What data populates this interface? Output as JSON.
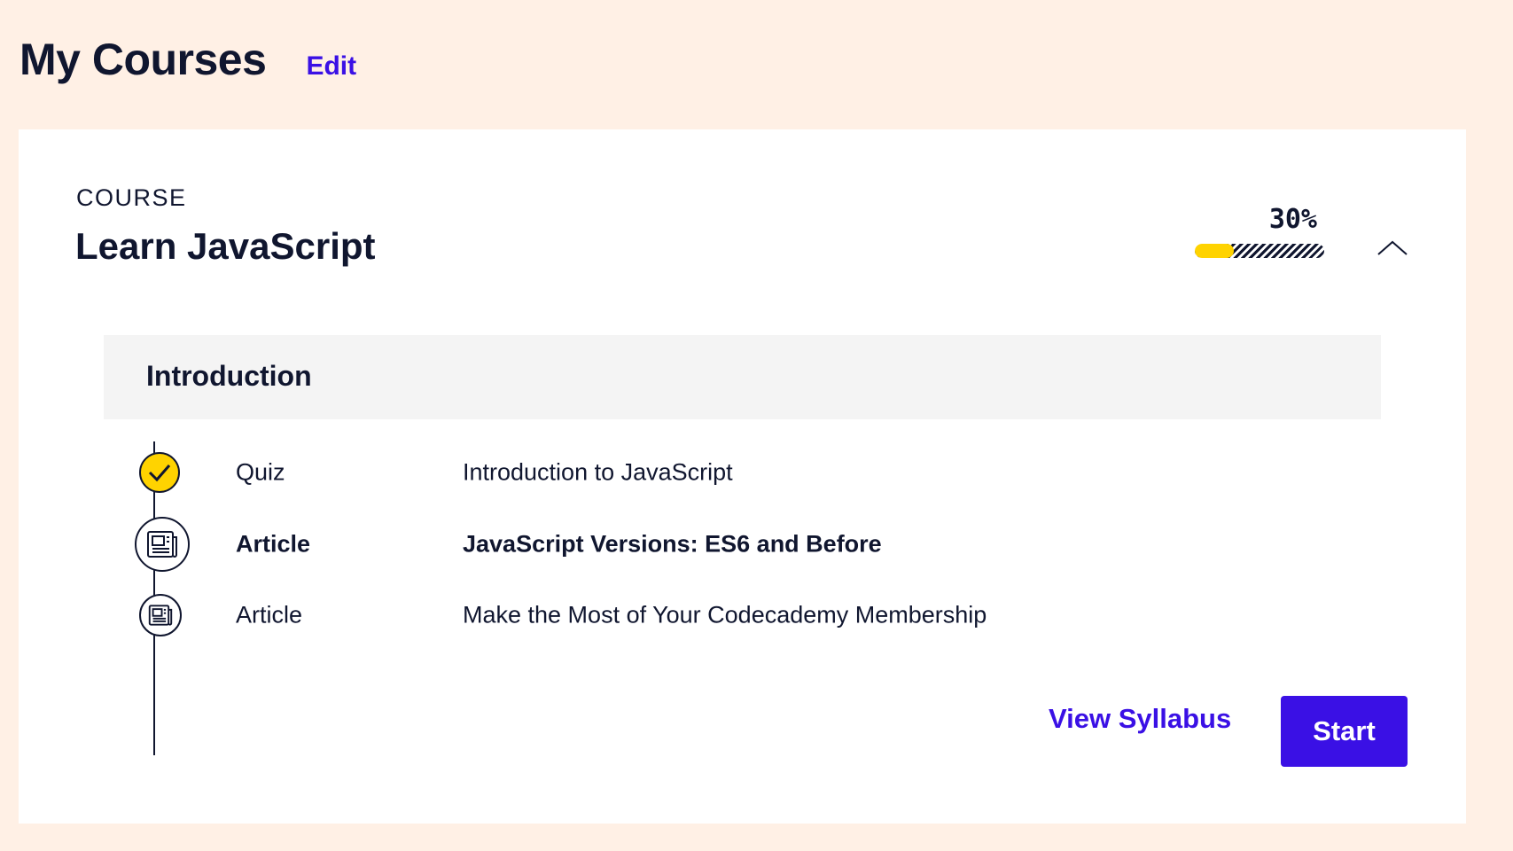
{
  "page": {
    "title": "My Courses",
    "edit_label": "Edit"
  },
  "course": {
    "eyebrow": "COURSE",
    "title": "Learn JavaScript",
    "progress_label": "30%",
    "progress_fraction": 0.3,
    "collapse_icon": "chevron-up-icon"
  },
  "section": {
    "title": "Introduction",
    "lessons": [
      {
        "type": "Quiz",
        "name": "Introduction to JavaScript",
        "status": "completed",
        "icon": "checkmark-icon"
      },
      {
        "type": "Article",
        "name": "JavaScript Versions: ES6 and Before",
        "status": "current",
        "icon": "article-icon"
      },
      {
        "type": "Article",
        "name": "Make the Most of Your Codecademy Membership",
        "status": "upcoming",
        "icon": "article-icon"
      }
    ]
  },
  "actions": {
    "view_syllabus_label": "View Syllabus",
    "start_label": "Start"
  },
  "colors": {
    "background": "#fff0e5",
    "accent": "#3a10e5",
    "progress": "#ffd300",
    "text": "#10162f"
  }
}
